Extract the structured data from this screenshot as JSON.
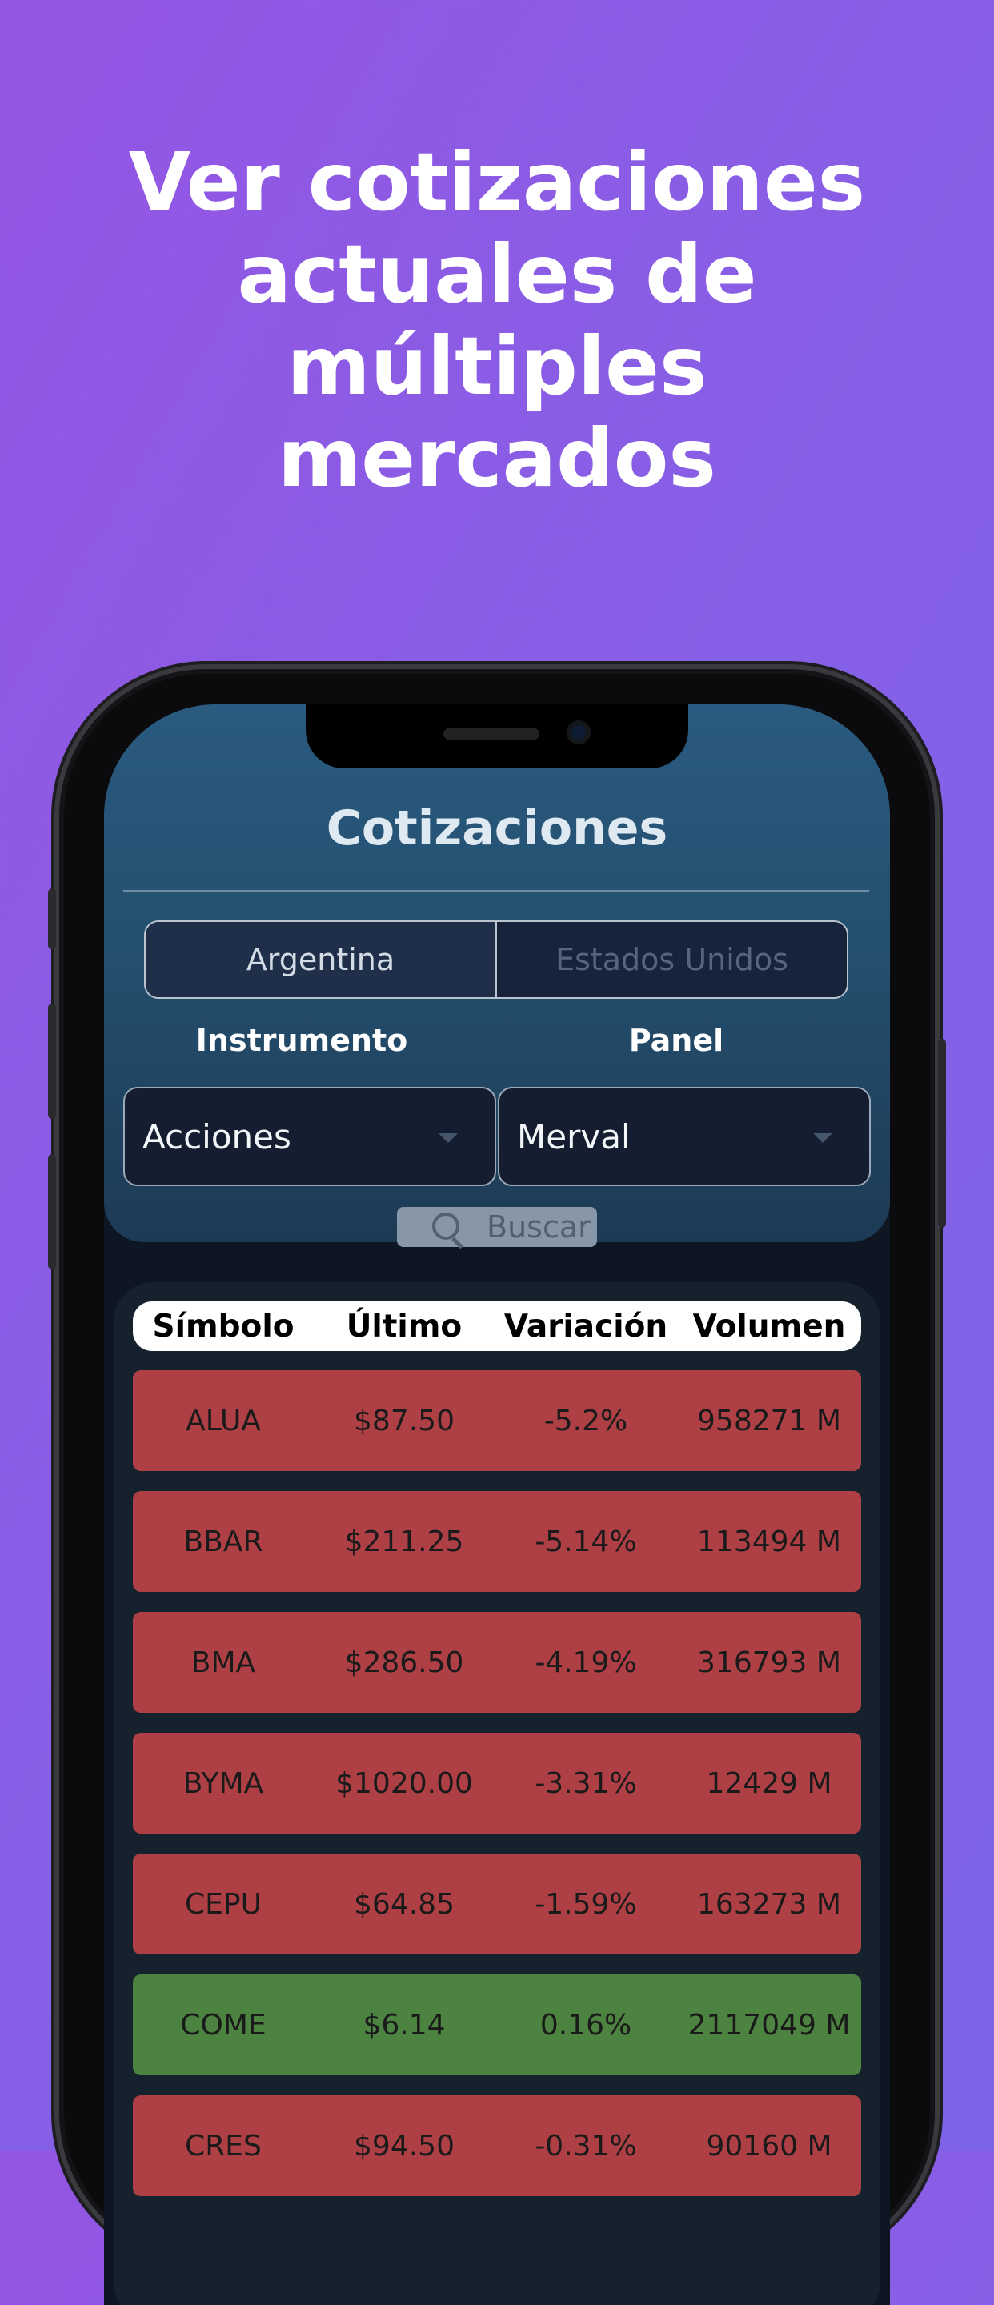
{
  "headline": {
    "line1": "Ver cotizaciones",
    "line2": "actuales de",
    "line3": "múltiples",
    "line4": "mercados"
  },
  "app": {
    "title": "Cotizaciones",
    "tabs": [
      {
        "label": "Argentina",
        "active": true
      },
      {
        "label": "Estados Unidos",
        "active": false
      }
    ],
    "instrumento": {
      "label": "Instrumento",
      "value": "Acciones"
    },
    "panel": {
      "label": "Panel",
      "value": "Merval"
    },
    "search": {
      "label": "Buscar",
      "icon": "search-icon"
    },
    "table": {
      "headers": [
        "Símbolo",
        "Último",
        "Variación",
        "Volumen"
      ],
      "rows": [
        {
          "symbol": "ALUA",
          "last": "$87.50",
          "change": "-5.2%",
          "volume": "958271 M",
          "trend": "down"
        },
        {
          "symbol": "BBAR",
          "last": "$211.25",
          "change": "-5.14%",
          "volume": "113494 M",
          "trend": "down"
        },
        {
          "symbol": "BMA",
          "last": "$286.50",
          "change": "-4.19%",
          "volume": "316793 M",
          "trend": "down"
        },
        {
          "symbol": "BYMA",
          "last": "$1020.00",
          "change": "-3.31%",
          "volume": "12429 M",
          "trend": "down"
        },
        {
          "symbol": "CEPU",
          "last": "$64.85",
          "change": "-1.59%",
          "volume": "163273 M",
          "trend": "down"
        },
        {
          "symbol": "COME",
          "last": "$6.14",
          "change": "0.16%",
          "volume": "2117049 M",
          "trend": "up"
        },
        {
          "symbol": "CRES",
          "last": "$94.50",
          "change": "-0.31%",
          "volume": "90160 M",
          "trend": "down"
        }
      ]
    }
  },
  "colors": {
    "down": "#ae4045",
    "up": "#4c8340",
    "background_start": "#9455e3",
    "background_end": "#7d63e6"
  }
}
